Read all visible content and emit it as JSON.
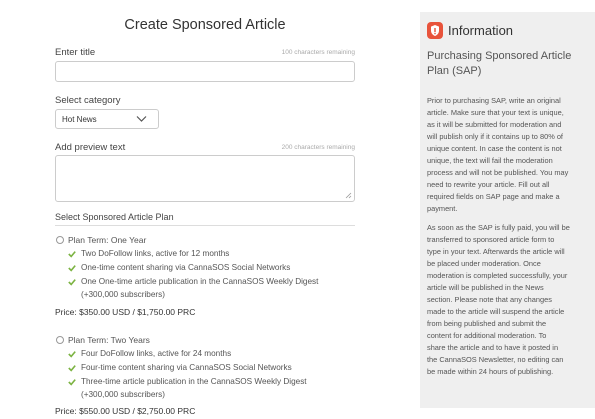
{
  "form": {
    "title": "Create Sponsored Article",
    "title_label": "Enter title",
    "title_hint": "100 characters remaining",
    "title_value": "",
    "category_label": "Select category",
    "category_value": "Hot News",
    "preview_label": "Add preview text",
    "preview_hint": "200 characters remaining",
    "preview_value": "",
    "plan_heading": "Select Sponsored Article Plan"
  },
  "plans": [
    {
      "label": "Plan Term: One Year",
      "features": [
        "Two DoFollow links, active for 12 months",
        "One-time content sharing via CannaSOS Social Networks",
        "One One-time article publication in the CannaSOS Weekly Digest",
        "(+300,000 subscribers)"
      ],
      "price": "Price: $350.00 USD / $1,750.00 PRC"
    },
    {
      "label": "Plan Term: Two Years",
      "features": [
        "Four DoFollow links, active for 24 months",
        "Four-time content sharing via CannaSOS Social Networks",
        "Three-time article publication in the CannaSOS Weekly Digest",
        "(+300,000 subscribers)"
      ],
      "price": "Price: $550.00 USD / $2,750.00 PRC"
    }
  ],
  "info": {
    "title": "Information",
    "subtitle_1": "Purchasing Sponsored Article",
    "subtitle_2": "Plan (SAP)",
    "p1": [
      "Prior to purchasing SAP, write an original",
      "article. Make sure that your text is unique,",
      "as it will be submitted for moderation and",
      "will publish only if it contains up to 80% of",
      "unique content. In case the content is not",
      "unique, the text will fail the moderation",
      "process and will not be published. You may",
      "need to rewrite your article. Fill out all",
      "required fields on SAP page and make a",
      "payment."
    ],
    "p2": [
      "As soon as the SAP is fully paid, you will be",
      "transferred to sponsored article form to",
      "type in your text. Afterwards the article will",
      "be placed under moderation. Once",
      "moderation is completed successfully, your",
      "article will be published in the News",
      "section. Please note that any changes",
      "made to the article will suspend the article",
      "from being published and submit the",
      "content for additional moderation. To",
      "share the article and to have it posted in",
      "the CannaSOS Newsletter, no editing can",
      "be made within 24 hours of publishing."
    ]
  },
  "colors": {
    "check": "#7cb342",
    "info_icon": "#e8533b",
    "panel_bg": "#efefef"
  },
  "icons": {
    "check": "checkmark-icon",
    "info": "shield-info-icon",
    "chevron": "chevron-down-icon",
    "radio": "radio-button"
  }
}
